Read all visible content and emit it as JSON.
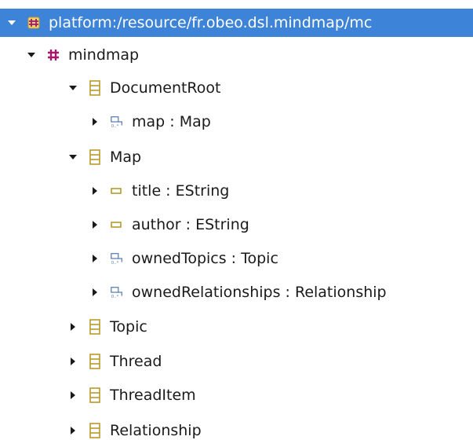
{
  "tree": {
    "resource": {
      "label": "platform:/resource/fr.obeo.dsl.mindmap/mc"
    },
    "package": {
      "label": "mindmap"
    },
    "classes": [
      {
        "label": "DocumentRoot",
        "children": [
          {
            "label": "map : Map"
          }
        ]
      },
      {
        "label": "Map",
        "children": [
          {
            "label": "title : EString"
          },
          {
            "label": "author : EString"
          },
          {
            "label": "ownedTopics : Topic"
          },
          {
            "label": "ownedRelationships : Relationship"
          }
        ]
      },
      {
        "label": "Topic"
      },
      {
        "label": "Thread"
      },
      {
        "label": "ThreadItem"
      },
      {
        "label": "Relationship"
      }
    ]
  },
  "colors": {
    "selection": "#3d84d8",
    "package_icon": "#a4186e",
    "class_icon": "#b89a2a",
    "reference_icon": "#5a7fb0",
    "attribute_icon": "#b89a2a"
  }
}
